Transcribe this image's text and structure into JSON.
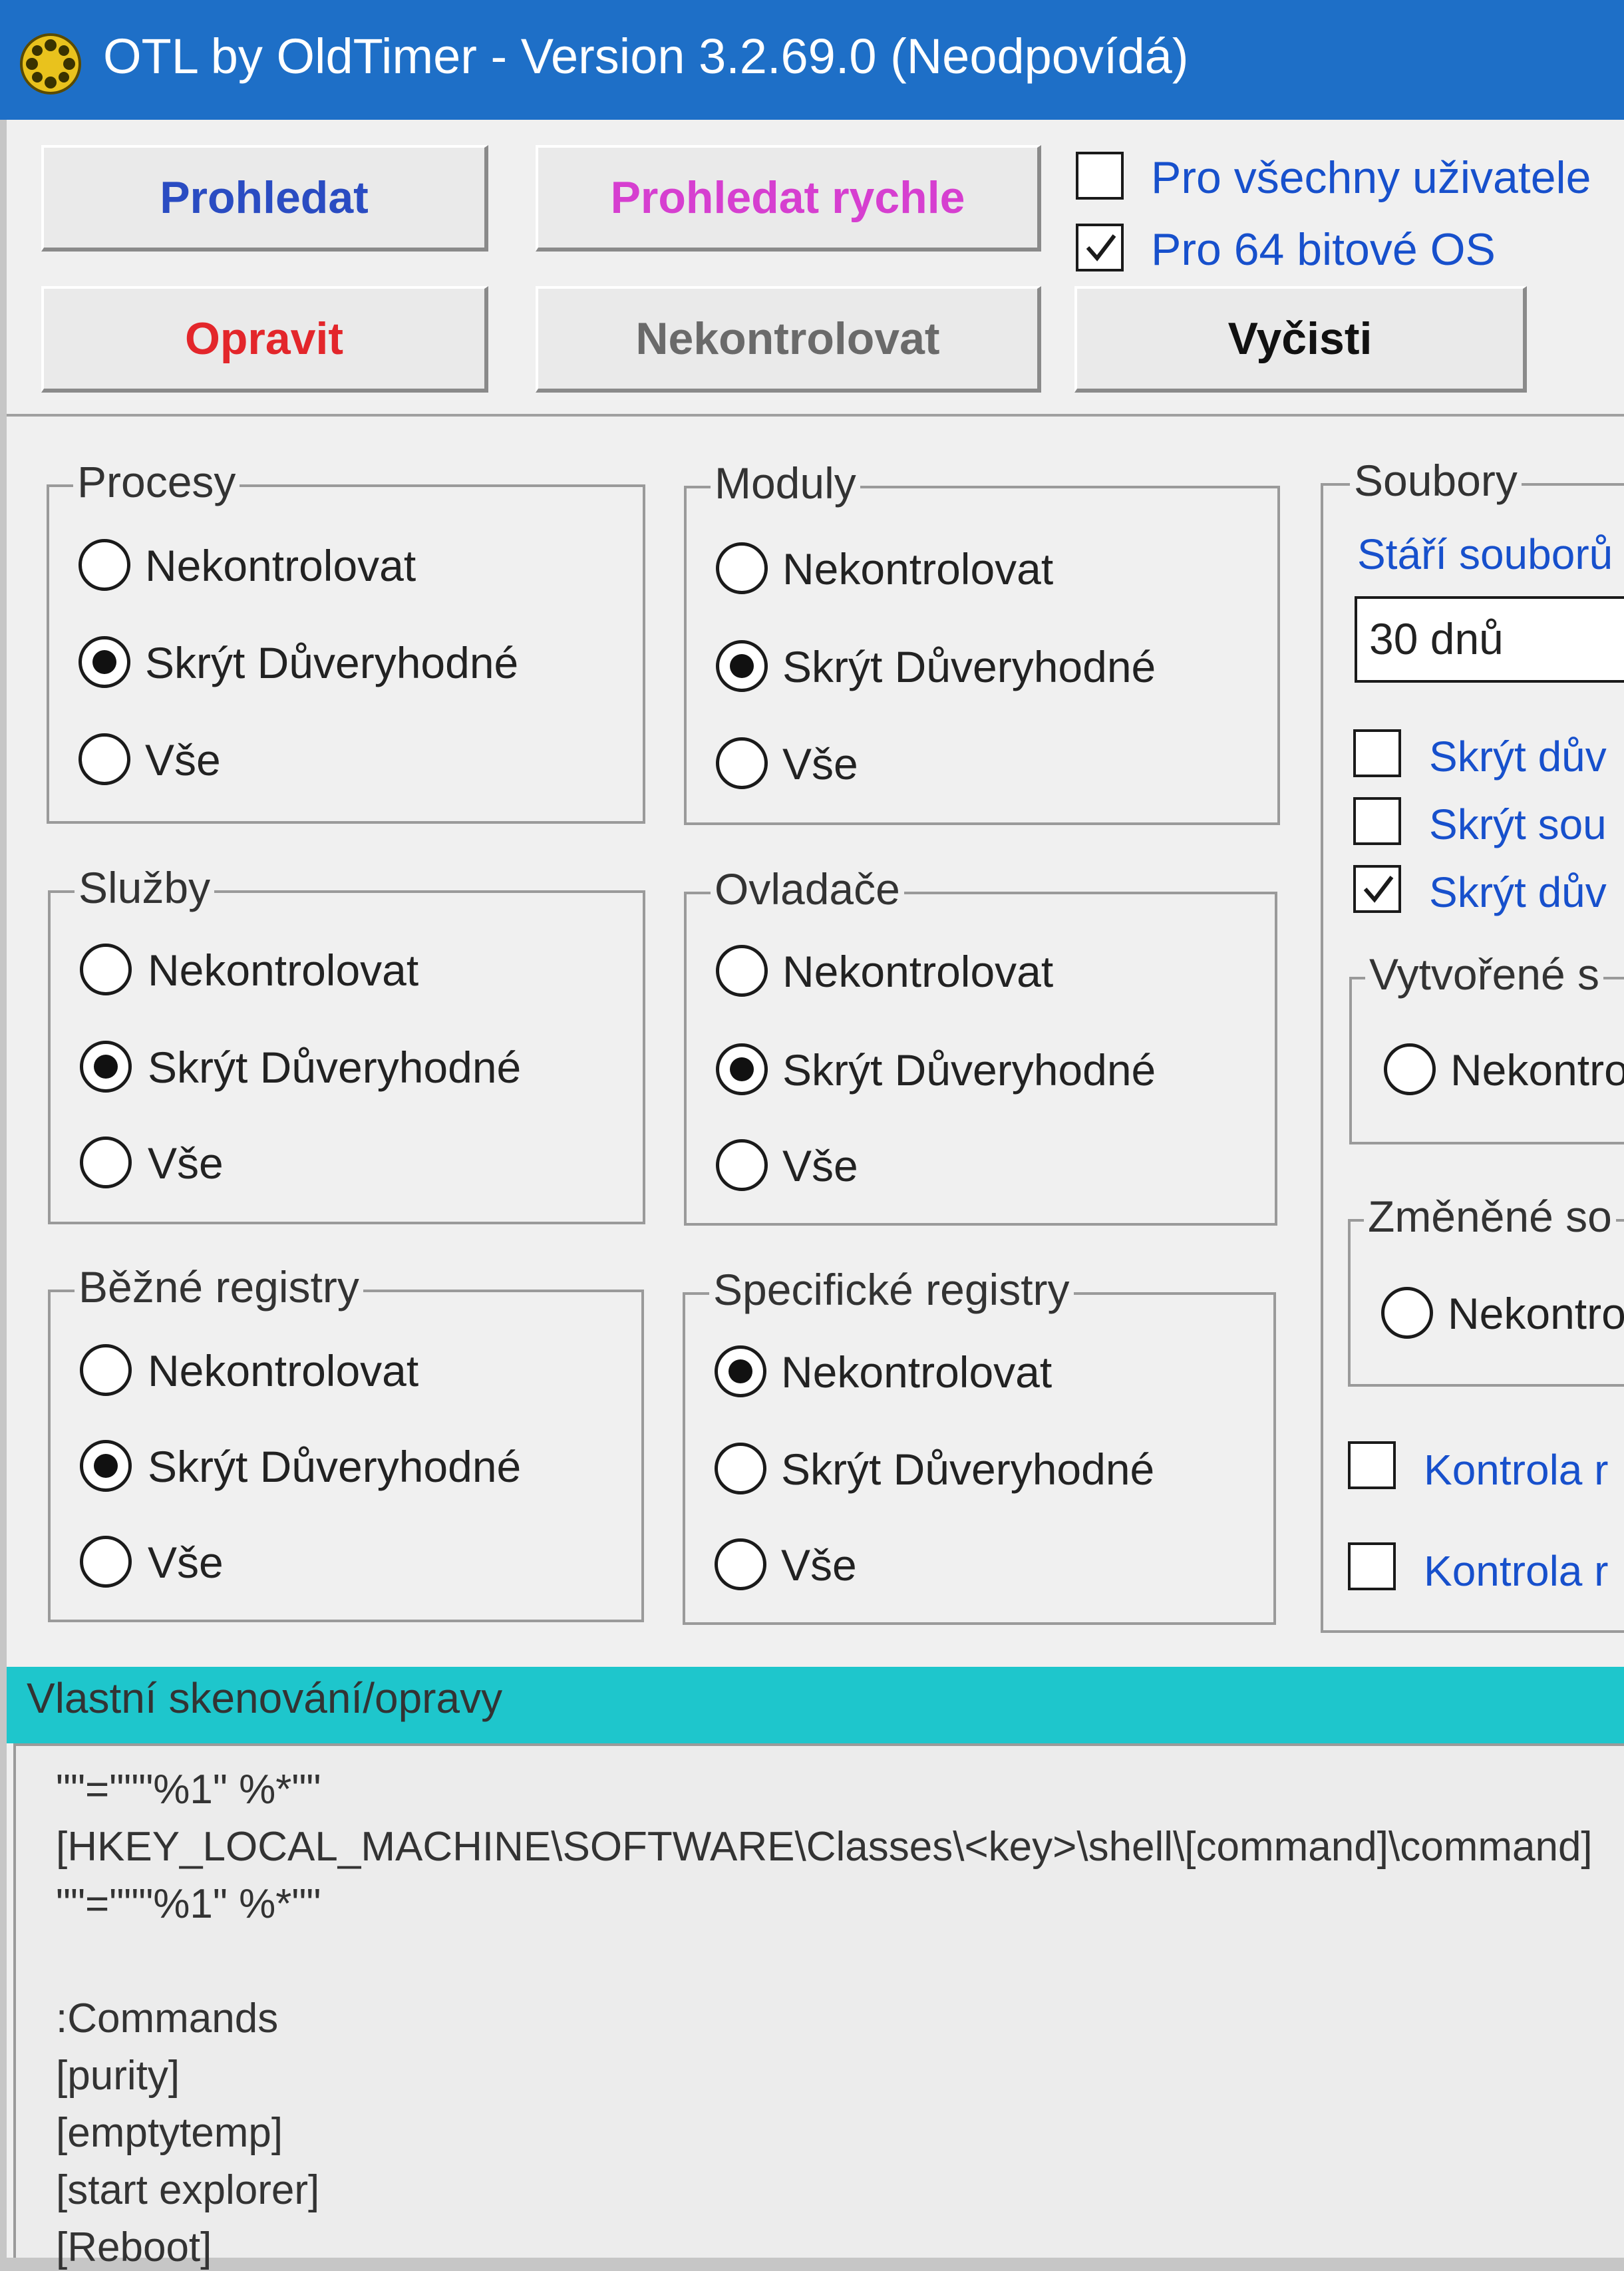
{
  "window": {
    "title": "OTL by OldTimer - Version 3.2.69.0 (Neodpovídá)"
  },
  "toolbar": {
    "scan_label": "Prohledat",
    "quick_scan_label": "Prohledat rychle",
    "fix_label": "Opravit",
    "no_check_label": "Nekontrolovat",
    "clean_label": "Vyčisti",
    "all_users_label": "Pro všechny uživatele",
    "all_users_checked": false,
    "os64_label": "Pro 64 bitové OS",
    "os64_checked": true,
    "colors": {
      "scan": "#2a4cc2",
      "quick_scan": "#d63fd0",
      "fix": "#e3262b",
      "disabled": "#6a6a6a",
      "clean": "#111111"
    }
  },
  "options": {
    "none": "Nekontrolovat",
    "hide_trusted": "Skrýt Důveryhodné",
    "all": "Vše"
  },
  "groups": {
    "processes": {
      "title": "Procesy",
      "selected": "hide_trusted"
    },
    "modules": {
      "title": "Moduly",
      "selected": "hide_trusted"
    },
    "services": {
      "title": "Služby",
      "selected": "hide_trusted"
    },
    "drivers": {
      "title": "Ovladače",
      "selected": "hide_trusted"
    },
    "std_registry": {
      "title": "Běžné registry",
      "selected": "hide_trusted"
    },
    "extra_registry": {
      "title": "Specifické registry",
      "selected": "none"
    }
  },
  "files": {
    "title": "Soubory",
    "age_label": "Stáří souborů",
    "age_value": "30 dnů",
    "checks": [
      {
        "label": "Skrýt dův",
        "checked": false
      },
      {
        "label": "Skrýt sou",
        "checked": false
      },
      {
        "label": "Skrýt dův",
        "checked": true
      }
    ],
    "created": {
      "title": "Vytvořené s",
      "option": "Nekontro"
    },
    "modified": {
      "title": "Změněné so",
      "option": "Nekontro"
    },
    "bottom_checks": [
      {
        "label": "Kontrola r",
        "checked": false
      },
      {
        "label": "Kontrola r",
        "checked": false
      }
    ]
  },
  "custom": {
    "title": "Vlastní skenování/opravy",
    "lines": [
      "\"\"=\"\"\"%1\" %*\"\"",
      "[HKEY_LOCAL_MACHINE\\SOFTWARE\\Classes\\<key>\\shell\\[command]\\command]",
      "\"\"=\"\"\"%1\" %*\"\"",
      "",
      ":Commands",
      "[purity]",
      "[emptytemp]",
      "[start explorer]",
      "[Reboot]"
    ]
  }
}
